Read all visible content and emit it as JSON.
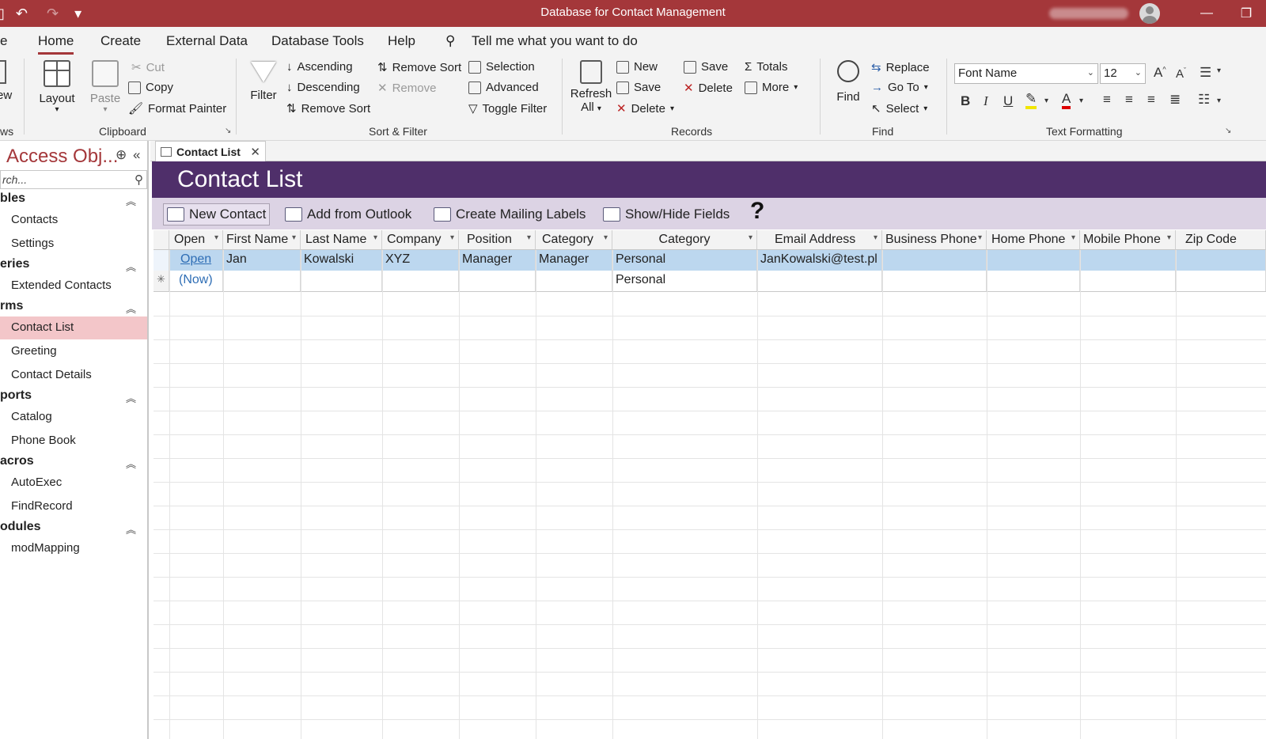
{
  "window": {
    "title": "Database for Contact Management",
    "minimize_glyph": "—",
    "restore_glyph": "❐"
  },
  "qat": {
    "save_glyph": "▯",
    "undo_glyph": "↶",
    "redo_glyph": "↷",
    "customize_glyph": "▾"
  },
  "menu": {
    "file_partial": "e",
    "tabs": [
      "Home",
      "Create",
      "External Data",
      "Database Tools",
      "Help"
    ],
    "tell_me": "Tell me what you want to do"
  },
  "ribbon": {
    "views_partial": "ew",
    "views_group_partial": "ws",
    "layout": "Layout",
    "clipboard": {
      "paste": "Paste",
      "cut": "Cut",
      "copy": "Copy",
      "format_painter": "Format Painter",
      "group": "Clipboard"
    },
    "sort_filter": {
      "filter": "Filter",
      "ascending": "Ascending",
      "descending": "Descending",
      "remove_sort_left": "Remove Sort",
      "remove_sort": "Remove Sort",
      "remove": "Remove",
      "selection": "Selection",
      "advanced": "Advanced",
      "toggle_filter": "Toggle Filter",
      "group": "Sort & Filter"
    },
    "records": {
      "refresh_line1": "Refresh",
      "refresh_line2": "All",
      "new": "New",
      "save_a": "Save",
      "delete_a": "Delete",
      "save_b": "Save",
      "delete_b": "Delete",
      "totals": "Totals",
      "more": "More",
      "group": "Records"
    },
    "find": {
      "find": "Find",
      "replace": "Replace",
      "goto": "Go To",
      "select": "Select",
      "group": "Find"
    },
    "text_formatting": {
      "font_name": "Font Name",
      "font_size": "12",
      "bold": "B",
      "italic": "I",
      "underline": "U",
      "font_color_letter": "A",
      "grow_font": "A",
      "shrink_font": "A",
      "group": "Text Formatting"
    }
  },
  "nav": {
    "title": "Access Obj...",
    "search_placeholder": "rch...",
    "sections": [
      {
        "label": "bles",
        "items": [
          "Contacts",
          "Settings"
        ]
      },
      {
        "label": "eries",
        "items": [
          "Extended Contacts"
        ]
      },
      {
        "label": "rms",
        "items": [
          "Contact List",
          "Greeting",
          "Contact Details"
        ]
      },
      {
        "label": "ports",
        "items": [
          "Catalog",
          "Phone Book"
        ]
      },
      {
        "label": "acros",
        "items": [
          "AutoExec",
          "FindRecord"
        ]
      },
      {
        "label": "odules",
        "items": [
          "modMapping"
        ]
      }
    ],
    "selected_item": "Contact List"
  },
  "document": {
    "tab_label": "Contact List",
    "form_title": "Contact List",
    "toolbar": {
      "new_contact": "New Contact",
      "add_from_outlook": "Add from Outlook",
      "create_mailing_labels": "Create Mailing Labels",
      "show_hide_fields": "Show/Hide Fields",
      "help": "?"
    },
    "columns": [
      "Open",
      "First Name",
      "Last Name",
      "Company",
      "Position",
      "Category",
      "Category",
      "Email Address",
      "Business Phone",
      "Home Phone",
      "Mobile Phone",
      "Zip Code"
    ],
    "rows": [
      [
        "Open",
        "Jan",
        "Kowalski",
        "XYZ",
        "Manager",
        "Manager",
        "Personal",
        "JanKowalski@test.pl",
        "",
        "",
        "",
        ""
      ],
      [
        "(Now)",
        "",
        "",
        "",
        "",
        "",
        "Personal",
        "",
        "",
        "",
        "",
        ""
      ]
    ],
    "new_row_marker": "✳"
  },
  "colors": {
    "accent": "#a4373a",
    "form_header": "#4f2f6a",
    "form_toolbar": "#dcd3e4",
    "selected_row": "#bcd7ef",
    "nav_selected": "#f3c6c9"
  }
}
